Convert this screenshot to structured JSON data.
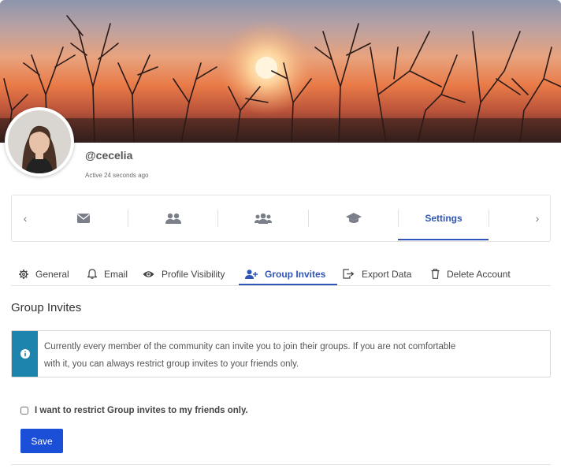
{
  "profile": {
    "username": "@cecelia",
    "active_text": "Active 24 seconds ago"
  },
  "nav": {
    "prev_arrow": "‹",
    "next_arrow": "›",
    "items": [
      {
        "icon": "envelope-icon"
      },
      {
        "icon": "user-pair-icon"
      },
      {
        "icon": "users-group-icon"
      },
      {
        "icon": "graduation-cap-icon"
      },
      {
        "label": "Settings"
      }
    ]
  },
  "tabs": [
    {
      "label": "General",
      "icon": "gear-icon"
    },
    {
      "label": "Email",
      "icon": "bell-icon"
    },
    {
      "label": "Profile Visibility",
      "icon": "eye-icon"
    },
    {
      "label": "Group Invites",
      "icon": "user-plus-icon",
      "active": true
    },
    {
      "label": "Export Data",
      "icon": "export-icon"
    },
    {
      "label": "Delete Account",
      "icon": "trash-icon"
    }
  ],
  "section": {
    "title": "Group Invites",
    "alert_line1": "Currently every member of the community can invite you to join their groups. If you are not comfortable",
    "alert_line2": "with it, you can always restrict group invites to your friends only.",
    "checkbox_label": "I want to restrict Group invites to my friends only.",
    "save_label": "Save"
  },
  "colors": {
    "accent": "#2f55b8",
    "button": "#1b4fd8",
    "info": "#1d85ad"
  }
}
